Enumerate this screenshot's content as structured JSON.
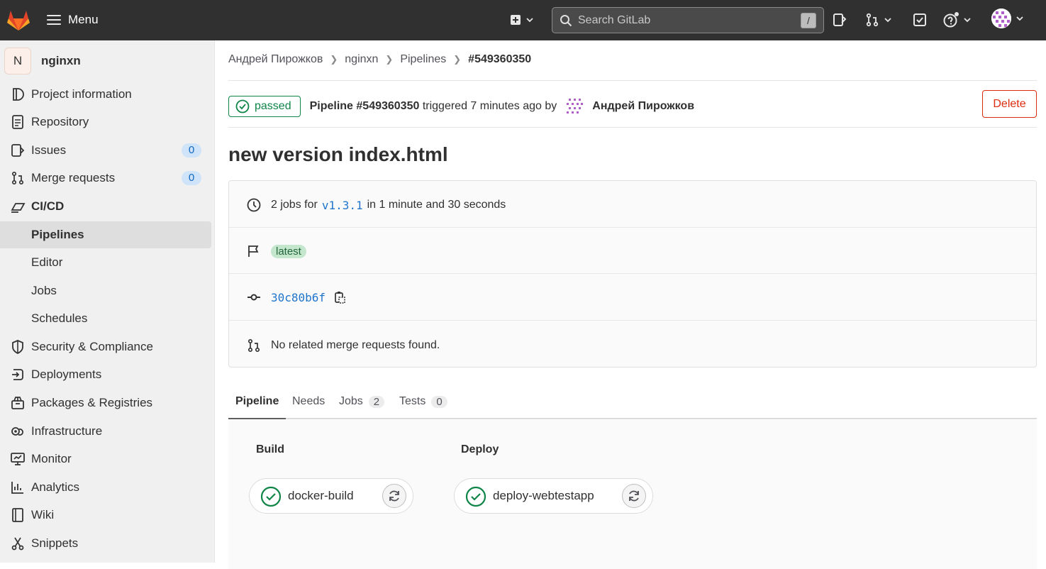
{
  "topbar": {
    "menu_label": "Menu",
    "search_placeholder": "Search GitLab",
    "search_shortcut": "/"
  },
  "sidebar": {
    "project_initial": "N",
    "project_name": "nginxn",
    "items": [
      {
        "label": "Project information",
        "icon": "info-icon"
      },
      {
        "label": "Repository",
        "icon": "doc-icon"
      },
      {
        "label": "Issues",
        "icon": "issues-icon",
        "count": "0"
      },
      {
        "label": "Merge requests",
        "icon": "merge-request-icon",
        "count": "0"
      },
      {
        "label": "CI/CD",
        "icon": "rocket-icon"
      },
      {
        "label": "Pipelines"
      },
      {
        "label": "Editor"
      },
      {
        "label": "Jobs"
      },
      {
        "label": "Schedules"
      },
      {
        "label": "Security & Compliance",
        "icon": "shield-icon"
      },
      {
        "label": "Deployments",
        "icon": "deployments-icon"
      },
      {
        "label": "Packages & Registries",
        "icon": "package-icon"
      },
      {
        "label": "Infrastructure",
        "icon": "cloud-gear-icon"
      },
      {
        "label": "Monitor",
        "icon": "monitor-icon"
      },
      {
        "label": "Analytics",
        "icon": "chart-icon"
      },
      {
        "label": "Wiki",
        "icon": "book-icon"
      },
      {
        "label": "Snippets",
        "icon": "snippet-icon"
      }
    ]
  },
  "breadcrumb": [
    "Андрей Пирожков",
    "nginxn",
    "Pipelines",
    "#549360350"
  ],
  "pipeline": {
    "status": "passed",
    "id_label": "Pipeline #549360350",
    "triggered_text": "triggered 7 minutes ago by",
    "author": "Андрей Пирожков",
    "delete_label": "Delete",
    "title": "new version index.html",
    "jobs_prefix": "2 jobs for",
    "ref": "v1.3.1",
    "duration": "in 1 minute and 30 seconds",
    "badge": "latest",
    "commit": "30c80b6f",
    "mr_text": "No related merge requests found."
  },
  "tabs": [
    {
      "label": "Pipeline"
    },
    {
      "label": "Needs"
    },
    {
      "label": "Jobs",
      "count": "2"
    },
    {
      "label": "Tests",
      "count": "0"
    }
  ],
  "stages": [
    {
      "name": "Build",
      "job": "docker-build"
    },
    {
      "name": "Deploy",
      "job": "deploy-webtestapp"
    }
  ],
  "colors": {
    "success": "#108548",
    "danger": "#dd2b0e",
    "link": "#1f75cb"
  }
}
